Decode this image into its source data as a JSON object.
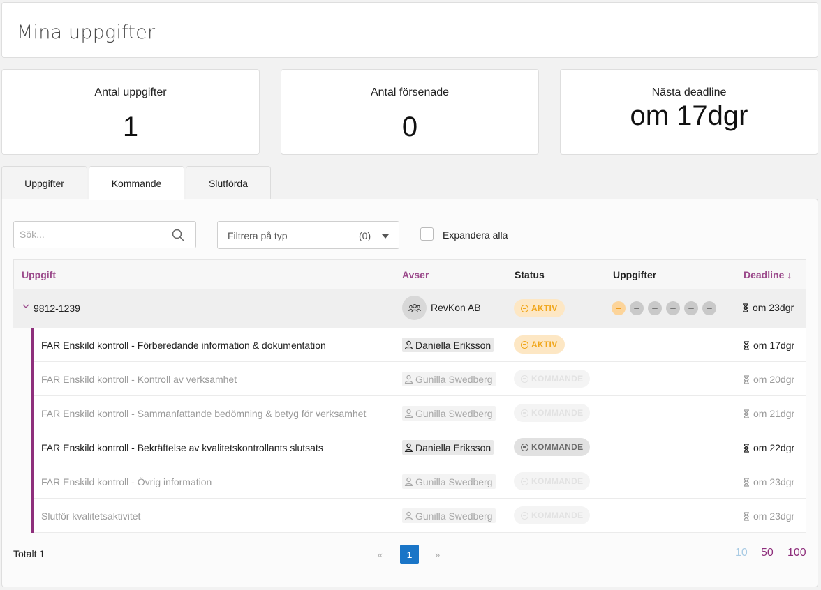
{
  "page": {
    "title": "Mina uppgifter"
  },
  "stats": [
    {
      "label": "Antal uppgifter",
      "value": "1"
    },
    {
      "label": "Antal försenade",
      "value": "0"
    },
    {
      "label": "Nästa deadline",
      "value": "om 17dgr"
    }
  ],
  "tabs": [
    {
      "label": "Uppgifter"
    },
    {
      "label": "Kommande",
      "active": true
    },
    {
      "label": "Slutförda"
    }
  ],
  "toolbar": {
    "search_placeholder": "Sök...",
    "filter_label": "Filtrera på typ",
    "filter_count": "(0)",
    "expand_label": "Expandera alla",
    "expand_checked": false
  },
  "table": {
    "headers": {
      "task": "Uppgift",
      "regarding": "Avser",
      "status": "Status",
      "subtasks": "Uppgifter",
      "deadline": "Deadline ↓"
    },
    "group": {
      "id": "9812-1239",
      "company": "RevKon AB",
      "status": "AKTIV",
      "deadline": "om 23dgr"
    },
    "rows": [
      {
        "name": "FAR Enskild kontroll - Förberedande information & dokumentation",
        "person": "Daniella Eriksson",
        "status": "AKTIV",
        "deadline": "om 17dgr"
      },
      {
        "name": "FAR Enskild kontroll - Kontroll av verksamhet",
        "person": "Gunilla Swedberg",
        "status": "KOMMANDE",
        "deadline": "om 20dgr"
      },
      {
        "name": "FAR Enskild kontroll - Sammanfattande bedömning & betyg för verksamhet",
        "person": "Gunilla Swedberg",
        "status": "KOMMANDE",
        "deadline": "om 21dgr"
      },
      {
        "name": "FAR Enskild kontroll - Bekräftelse av kvalitetskontrollants slutsats",
        "person": "Daniella Eriksson",
        "status": "KOMMANDE",
        "deadline": "om 22dgr"
      },
      {
        "name": "FAR Enskild kontroll - Övrig information",
        "person": "Gunilla Swedberg",
        "status": "KOMMANDE",
        "deadline": "om 23dgr"
      },
      {
        "name": "Slutför kvalitetsaktivitet",
        "person": "Gunilla Swedberg",
        "status": "KOMMANDE",
        "deadline": "om 23dgr"
      }
    ]
  },
  "footer": {
    "total": "Totalt 1",
    "prev": "«",
    "current_page": "1",
    "next": "»",
    "page_sizes": [
      "10",
      "50",
      "100"
    ]
  },
  "colors": {
    "accent": "#8e2f7c",
    "header_link": "#9b4a8b",
    "page_active": "#1a75c7",
    "aktiv_bg": "#fde7c4",
    "aktiv_fg": "#f0a61b"
  }
}
